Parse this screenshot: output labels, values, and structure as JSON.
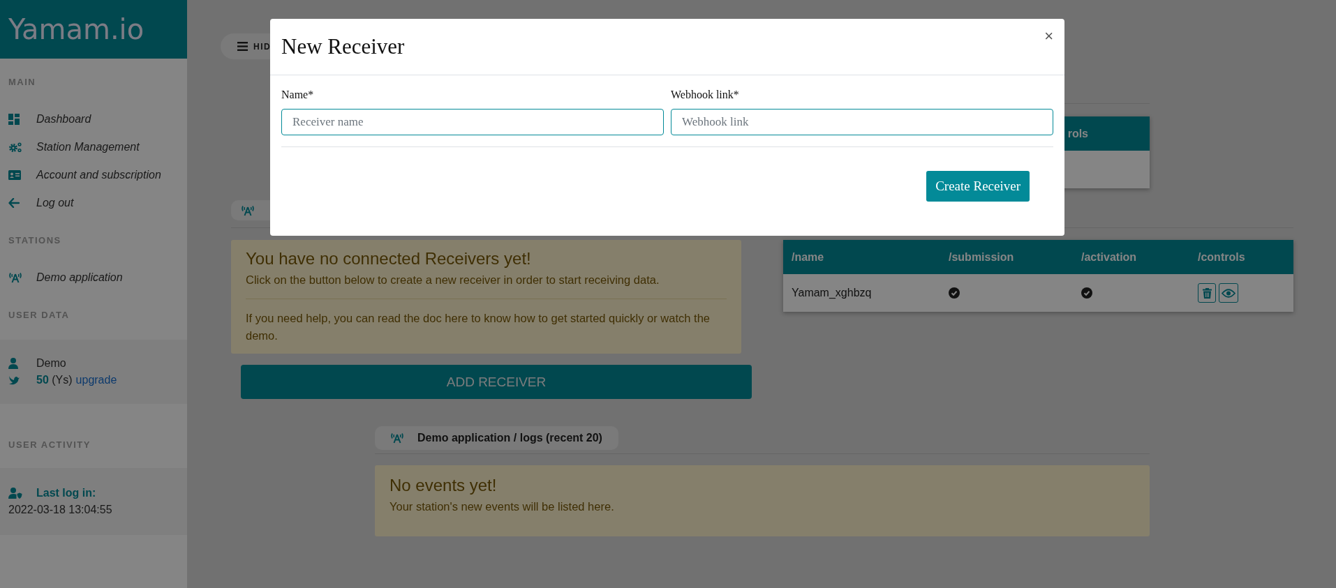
{
  "sidebar": {
    "logo": "Yamam.io",
    "sections": [
      {
        "heading": "MAIN",
        "items": [
          {
            "label": "Dashboard",
            "kind": "dashboard"
          },
          {
            "label": "Station Management",
            "kind": "gears"
          },
          {
            "label": "Account and subscription",
            "kind": "card"
          },
          {
            "label": "Log out",
            "kind": "back"
          }
        ]
      },
      {
        "heading": "STATIONS",
        "items": [
          {
            "label": "Demo application",
            "kind": "station"
          }
        ]
      }
    ],
    "user_data": {
      "heading": "USER DATA",
      "name": "Demo",
      "credits": "**50** (Ys)",
      "upgrade_link": "upgrade"
    },
    "user_activity": {
      "heading": "USER ACTIVITY",
      "label": "Last log in:",
      "value": "2022-03-18 13:04:55"
    }
  },
  "main": {
    "hide_button": "HID",
    "top_table": {
      "header_fragment": "rols"
    },
    "notice": {
      "title": "You have no connected Receivers yet!",
      "text": "Click on the button below to create a new receiver in order to start receiving data.",
      "help": "If you need help, you can read the doc here to know how to get started quickly or watch the demo."
    },
    "add_button": "ADD RECEIVER",
    "receivers_table": {
      "columns": [
        "/name",
        "/submission",
        "/activation",
        "/controls"
      ],
      "rows": [
        {
          "name": "Yamam_xghbzq",
          "submission": true,
          "activation": true
        }
      ]
    },
    "logs": {
      "title": "Demo application / logs (recent 20)",
      "empty_title": "No events yet!",
      "empty_text": "Your station's new events will be listed here."
    }
  },
  "modal": {
    "title": "New Receiver",
    "close": "×",
    "fields": [
      {
        "label": "Name*",
        "placeholder": "Receiver name"
      },
      {
        "label": "Webhook link*",
        "placeholder": "Webhook link"
      }
    ],
    "submit": "Create Receiver"
  }
}
